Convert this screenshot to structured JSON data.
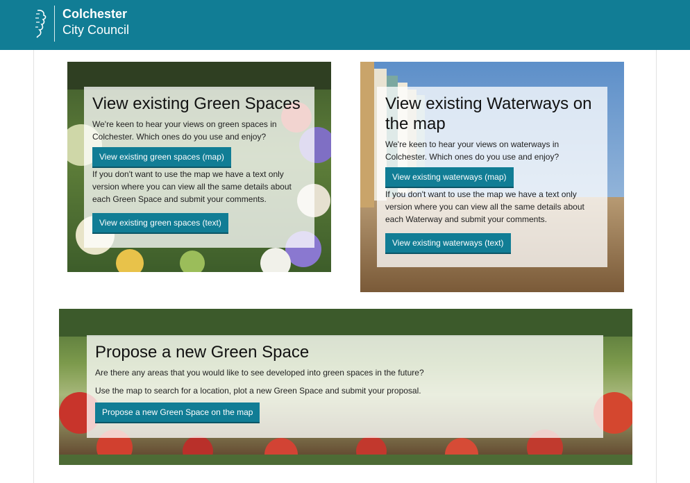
{
  "header": {
    "logo_line1": "Colchester",
    "logo_line2": "City Council",
    "brand_color": "#117d95"
  },
  "cards": {
    "green": {
      "title": "View existing Green Spaces",
      "intro": "We're keen to hear your views on green spaces in Colchester. Which ones do you use and enjoy?",
      "map_button": "View existing green spaces (map)",
      "text_note": "If you don't want to use the map we have a text only version where you can view all the same details about each Green Space and submit your comments.",
      "text_button": "View existing green spaces (text)"
    },
    "water": {
      "title": "View existing Waterways on the map",
      "intro": "We're keen to hear your views on waterways in Colchester. Which ones do you use and enjoy?",
      "map_button": "View existing waterways (map)",
      "text_note": "If you don't want to use the map we have a text only version where you can view all the same details about each Waterway and submit your comments.",
      "text_button": "View existing waterways (text)"
    },
    "propose": {
      "title": "Propose a new Green Space",
      "question": "Are there any areas that you would like to see developed into green spaces in the future?",
      "instruction": "Use the map to search for a location, plot a new Green Space and submit your proposal.",
      "button": "Propose a new Green Space on the map"
    }
  }
}
